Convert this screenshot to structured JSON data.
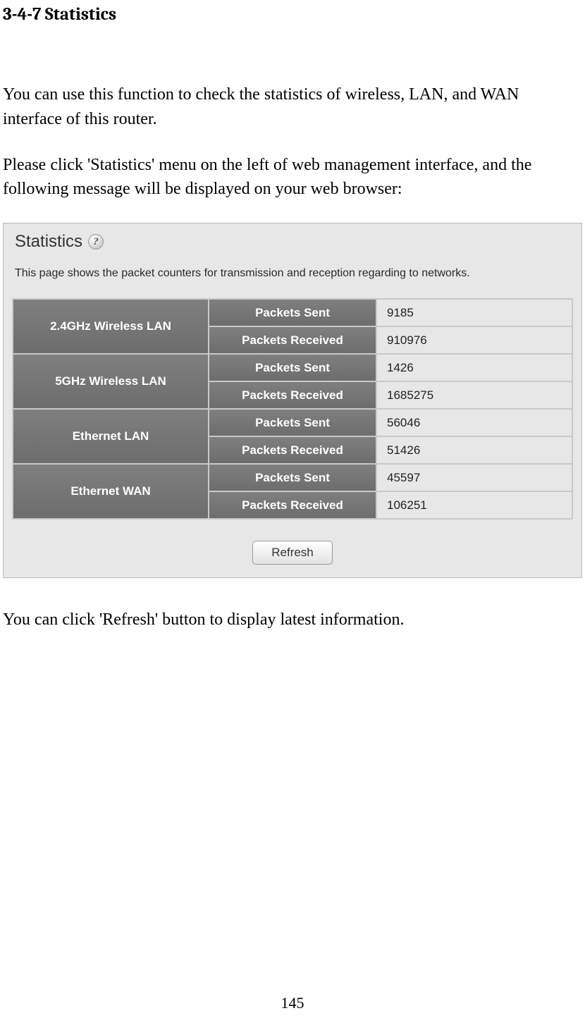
{
  "heading": "3-4-7 Statistics",
  "para1": "You can use this function to check the statistics of wireless, LAN, and WAN interface of this router.",
  "para2": "Please click 'Statistics' menu on the left of web management interface, and the following message will be displayed on your web browser:",
  "para3": "You can click 'Refresh' button to display latest information.",
  "page_number": "145",
  "screenshot": {
    "title": "Statistics",
    "help_glyph": "?",
    "description": "This page shows the packet counters for transmission and reception regarding to networks.",
    "labels": {
      "packets_sent": "Packets Sent",
      "packets_received": "Packets Received"
    },
    "rows": [
      {
        "name": "2.4GHz Wireless LAN",
        "sent": "9185",
        "received": "910976"
      },
      {
        "name": "5GHz Wireless LAN",
        "sent": "1426",
        "received": "1685275"
      },
      {
        "name": "Ethernet LAN",
        "sent": "56046",
        "received": "51426"
      },
      {
        "name": "Ethernet WAN",
        "sent": "45597",
        "received": "106251"
      }
    ],
    "refresh_label": "Refresh"
  }
}
